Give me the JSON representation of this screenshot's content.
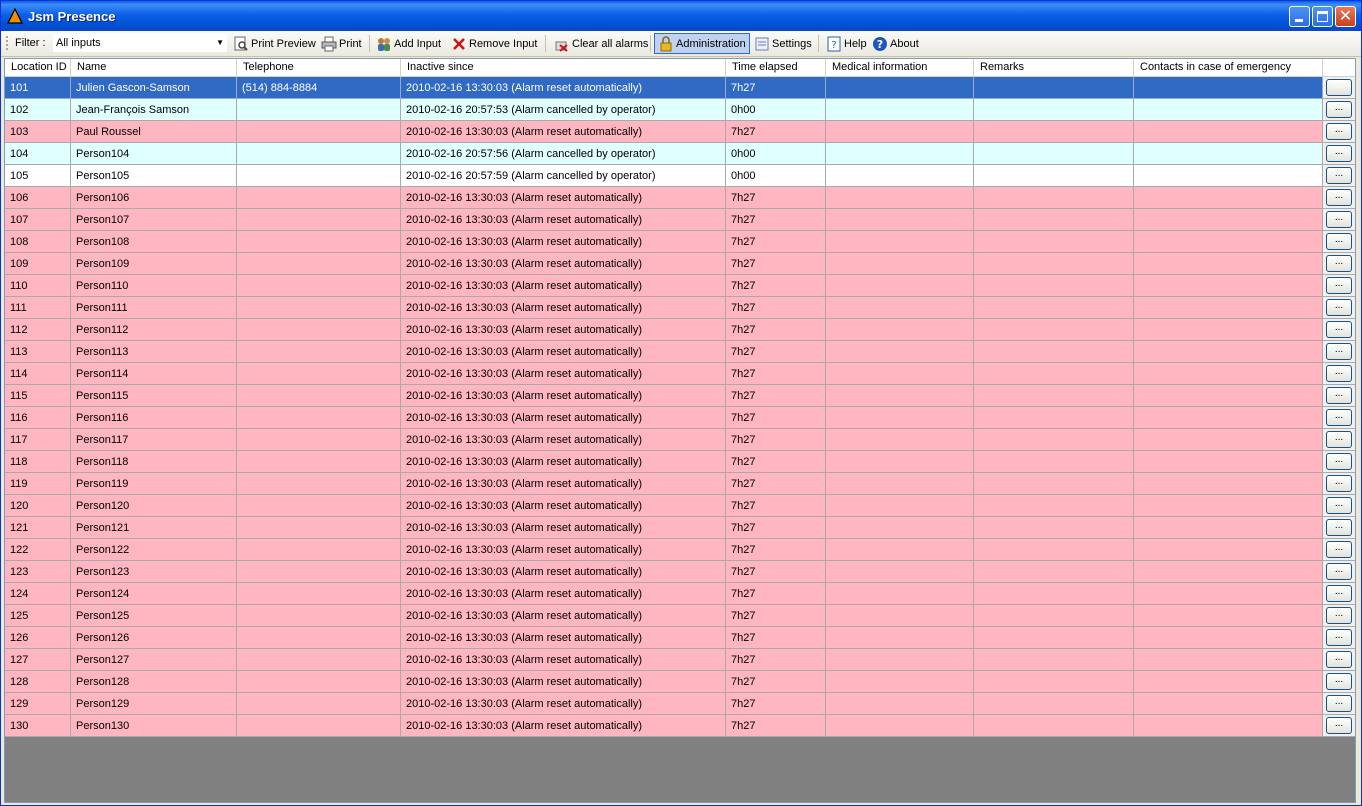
{
  "window": {
    "title": "Jsm Presence",
    "accent": "#0052d9"
  },
  "toolbar": {
    "filter_label": "Filter :",
    "filter_value": "All inputs",
    "print_preview": "Print Preview",
    "print": "Print",
    "add_input": "Add Input",
    "remove_input": "Remove Input",
    "clear_alarms": "Clear all alarms",
    "administration": "Administration",
    "settings": "Settings",
    "help": "Help",
    "about": "About"
  },
  "grid": {
    "columns": [
      "Location ID",
      "Name",
      "Telephone",
      "Inactive since",
      "Time elapsed",
      "Medical information",
      "Remarks",
      "Contacts in case of emergency"
    ],
    "row_button_label": "...",
    "colors": {
      "alarm": "#ffb6c1",
      "cancelled": "#e0ffff",
      "normal": "#ffffff",
      "selected": "#316ac5"
    },
    "rows": [
      {
        "id": "101",
        "name": "Julien Gascon-Samson",
        "phone": "(514) 884-8884",
        "since": "2010-02-16 13:30:03 (Alarm reset automatically)",
        "elapsed": "7h27",
        "medical": "",
        "remarks": "",
        "contacts": "",
        "state": "selected"
      },
      {
        "id": "102",
        "name": "Jean-François Samson",
        "phone": "",
        "since": "2010-02-16 20:57:53 (Alarm cancelled by operator)",
        "elapsed": "0h00",
        "medical": "",
        "remarks": "",
        "contacts": "",
        "state": "cancelled"
      },
      {
        "id": "103",
        "name": "Paul Roussel",
        "phone": "",
        "since": "2010-02-16 13:30:03 (Alarm reset automatically)",
        "elapsed": "7h27",
        "medical": "",
        "remarks": "",
        "contacts": "",
        "state": "alarm"
      },
      {
        "id": "104",
        "name": "Person104",
        "phone": "",
        "since": "2010-02-16 20:57:56 (Alarm cancelled by operator)",
        "elapsed": "0h00",
        "medical": "",
        "remarks": "",
        "contacts": "",
        "state": "cancelled"
      },
      {
        "id": "105",
        "name": "Person105",
        "phone": "",
        "since": "2010-02-16 20:57:59 (Alarm cancelled by operator)",
        "elapsed": "0h00",
        "medical": "",
        "remarks": "",
        "contacts": "",
        "state": "normal"
      },
      {
        "id": "106",
        "name": "Person106",
        "phone": "",
        "since": "2010-02-16 13:30:03 (Alarm reset automatically)",
        "elapsed": "7h27",
        "medical": "",
        "remarks": "",
        "contacts": "",
        "state": "alarm"
      },
      {
        "id": "107",
        "name": "Person107",
        "phone": "",
        "since": "2010-02-16 13:30:03 (Alarm reset automatically)",
        "elapsed": "7h27",
        "medical": "",
        "remarks": "",
        "contacts": "",
        "state": "alarm"
      },
      {
        "id": "108",
        "name": "Person108",
        "phone": "",
        "since": "2010-02-16 13:30:03 (Alarm reset automatically)",
        "elapsed": "7h27",
        "medical": "",
        "remarks": "",
        "contacts": "",
        "state": "alarm"
      },
      {
        "id": "109",
        "name": "Person109",
        "phone": "",
        "since": "2010-02-16 13:30:03 (Alarm reset automatically)",
        "elapsed": "7h27",
        "medical": "",
        "remarks": "",
        "contacts": "",
        "state": "alarm"
      },
      {
        "id": "110",
        "name": "Person110",
        "phone": "",
        "since": "2010-02-16 13:30:03 (Alarm reset automatically)",
        "elapsed": "7h27",
        "medical": "",
        "remarks": "",
        "contacts": "",
        "state": "alarm"
      },
      {
        "id": "111",
        "name": "Person111",
        "phone": "",
        "since": "2010-02-16 13:30:03 (Alarm reset automatically)",
        "elapsed": "7h27",
        "medical": "",
        "remarks": "",
        "contacts": "",
        "state": "alarm"
      },
      {
        "id": "112",
        "name": "Person112",
        "phone": "",
        "since": "2010-02-16 13:30:03 (Alarm reset automatically)",
        "elapsed": "7h27",
        "medical": "",
        "remarks": "",
        "contacts": "",
        "state": "alarm"
      },
      {
        "id": "113",
        "name": "Person113",
        "phone": "",
        "since": "2010-02-16 13:30:03 (Alarm reset automatically)",
        "elapsed": "7h27",
        "medical": "",
        "remarks": "",
        "contacts": "",
        "state": "alarm"
      },
      {
        "id": "114",
        "name": "Person114",
        "phone": "",
        "since": "2010-02-16 13:30:03 (Alarm reset automatically)",
        "elapsed": "7h27",
        "medical": "",
        "remarks": "",
        "contacts": "",
        "state": "alarm"
      },
      {
        "id": "115",
        "name": "Person115",
        "phone": "",
        "since": "2010-02-16 13:30:03 (Alarm reset automatically)",
        "elapsed": "7h27",
        "medical": "",
        "remarks": "",
        "contacts": "",
        "state": "alarm"
      },
      {
        "id": "116",
        "name": "Person116",
        "phone": "",
        "since": "2010-02-16 13:30:03 (Alarm reset automatically)",
        "elapsed": "7h27",
        "medical": "",
        "remarks": "",
        "contacts": "",
        "state": "alarm"
      },
      {
        "id": "117",
        "name": "Person117",
        "phone": "",
        "since": "2010-02-16 13:30:03 (Alarm reset automatically)",
        "elapsed": "7h27",
        "medical": "",
        "remarks": "",
        "contacts": "",
        "state": "alarm"
      },
      {
        "id": "118",
        "name": "Person118",
        "phone": "",
        "since": "2010-02-16 13:30:03 (Alarm reset automatically)",
        "elapsed": "7h27",
        "medical": "",
        "remarks": "",
        "contacts": "",
        "state": "alarm"
      },
      {
        "id": "119",
        "name": "Person119",
        "phone": "",
        "since": "2010-02-16 13:30:03 (Alarm reset automatically)",
        "elapsed": "7h27",
        "medical": "",
        "remarks": "",
        "contacts": "",
        "state": "alarm"
      },
      {
        "id": "120",
        "name": "Person120",
        "phone": "",
        "since": "2010-02-16 13:30:03 (Alarm reset automatically)",
        "elapsed": "7h27",
        "medical": "",
        "remarks": "",
        "contacts": "",
        "state": "alarm"
      },
      {
        "id": "121",
        "name": "Person121",
        "phone": "",
        "since": "2010-02-16 13:30:03 (Alarm reset automatically)",
        "elapsed": "7h27",
        "medical": "",
        "remarks": "",
        "contacts": "",
        "state": "alarm"
      },
      {
        "id": "122",
        "name": "Person122",
        "phone": "",
        "since": "2010-02-16 13:30:03 (Alarm reset automatically)",
        "elapsed": "7h27",
        "medical": "",
        "remarks": "",
        "contacts": "",
        "state": "alarm"
      },
      {
        "id": "123",
        "name": "Person123",
        "phone": "",
        "since": "2010-02-16 13:30:03 (Alarm reset automatically)",
        "elapsed": "7h27",
        "medical": "",
        "remarks": "",
        "contacts": "",
        "state": "alarm"
      },
      {
        "id": "124",
        "name": "Person124",
        "phone": "",
        "since": "2010-02-16 13:30:03 (Alarm reset automatically)",
        "elapsed": "7h27",
        "medical": "",
        "remarks": "",
        "contacts": "",
        "state": "alarm"
      },
      {
        "id": "125",
        "name": "Person125",
        "phone": "",
        "since": "2010-02-16 13:30:03 (Alarm reset automatically)",
        "elapsed": "7h27",
        "medical": "",
        "remarks": "",
        "contacts": "",
        "state": "alarm"
      },
      {
        "id": "126",
        "name": "Person126",
        "phone": "",
        "since": "2010-02-16 13:30:03 (Alarm reset automatically)",
        "elapsed": "7h27",
        "medical": "",
        "remarks": "",
        "contacts": "",
        "state": "alarm"
      },
      {
        "id": "127",
        "name": "Person127",
        "phone": "",
        "since": "2010-02-16 13:30:03 (Alarm reset automatically)",
        "elapsed": "7h27",
        "medical": "",
        "remarks": "",
        "contacts": "",
        "state": "alarm"
      },
      {
        "id": "128",
        "name": "Person128",
        "phone": "",
        "since": "2010-02-16 13:30:03 (Alarm reset automatically)",
        "elapsed": "7h27",
        "medical": "",
        "remarks": "",
        "contacts": "",
        "state": "alarm"
      },
      {
        "id": "129",
        "name": "Person129",
        "phone": "",
        "since": "2010-02-16 13:30:03 (Alarm reset automatically)",
        "elapsed": "7h27",
        "medical": "",
        "remarks": "",
        "contacts": "",
        "state": "alarm"
      },
      {
        "id": "130",
        "name": "Person130",
        "phone": "",
        "since": "2010-02-16 13:30:03 (Alarm reset automatically)",
        "elapsed": "7h27",
        "medical": "",
        "remarks": "",
        "contacts": "",
        "state": "alarm"
      }
    ]
  }
}
